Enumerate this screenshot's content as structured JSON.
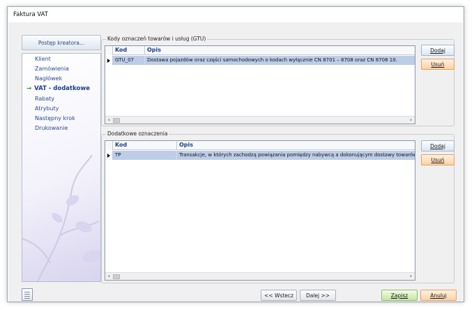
{
  "window": {
    "title": "Faktura VAT"
  },
  "wizard": {
    "progress_button": "Postęp kreatora...",
    "active_marker": "→",
    "steps": [
      {
        "label": "Klient",
        "active": false
      },
      {
        "label": "Zamówienia",
        "active": false
      },
      {
        "label": "Nagłówek",
        "active": false
      },
      {
        "label": "VAT - dodatkowe",
        "active": true
      },
      {
        "label": "Rabaty",
        "active": false
      },
      {
        "label": "Atrybuty",
        "active": false
      },
      {
        "label": "Następny krok",
        "active": false
      },
      {
        "label": "Drukowanie",
        "active": false
      }
    ]
  },
  "gtu": {
    "title": "Kody oznaczeń towarów i usług (GTU)",
    "columns": {
      "kod": "Kod",
      "opis": "Opis"
    },
    "rows": [
      {
        "kod": "GTU_07",
        "opis": "Dostawa pojazdów oraz części samochodowych o kodach wyłącznie CN 8701 – 8708 oraz CN 8708 10.",
        "selected": true
      }
    ],
    "buttons": {
      "add_label": "Dodaj",
      "remove_label": "Usuń"
    }
  },
  "extra": {
    "title": "Dodatkowe oznaczenia",
    "columns": {
      "kod": "Kod",
      "opis": "Opis"
    },
    "rows": [
      {
        "kod": "TP",
        "opis": "Transakcje, w których zachodzą powiązania pomiędzy nabywcą a dokonującym dostawy towarów lub świadcz",
        "selected": true
      }
    ],
    "buttons": {
      "add_label": "Dodaj",
      "remove_label": "Usuń"
    }
  },
  "footer": {
    "back_label": "<< Wstecz",
    "next_label": "Dalej >>",
    "save_label": "Zapisz",
    "cancel_label": "Anuluj"
  },
  "icons": {
    "scroll_left": "‹",
    "scroll_right": "›"
  },
  "colors": {
    "accent": "#1f3f86",
    "selection": "#bccde8",
    "orange_button": "#fdd1a6",
    "green_button": "#c4e6a4",
    "active_arrow": "#2e8b2e"
  }
}
